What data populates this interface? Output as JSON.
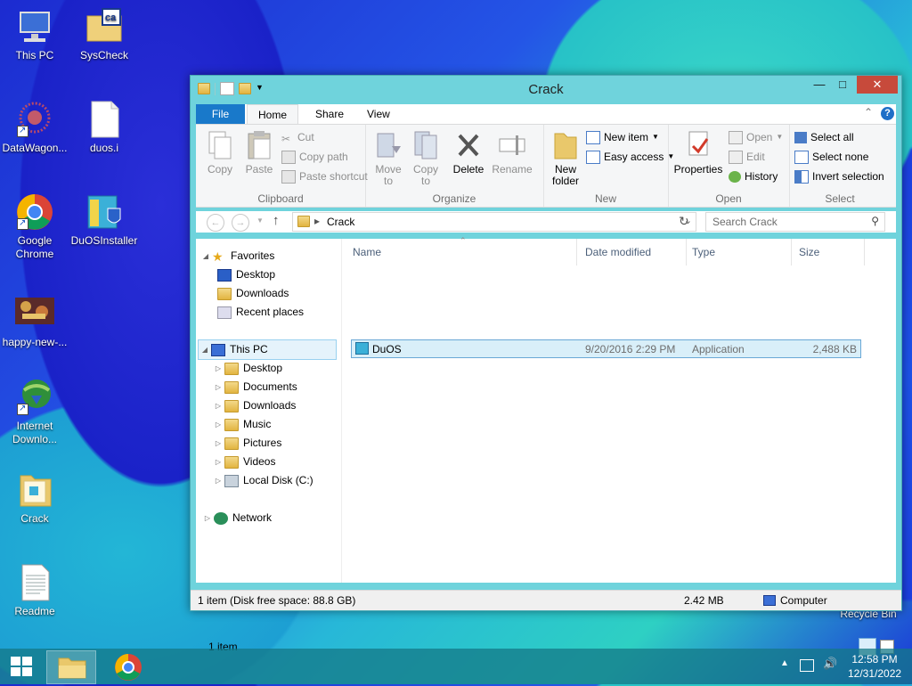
{
  "desktop": {
    "icons": [
      {
        "label": "This PC"
      },
      {
        "label": "SysCheck"
      },
      {
        "label": "DataWagon..."
      },
      {
        "label": "duos.i"
      },
      {
        "label": "Google Chrome"
      },
      {
        "label": "DuOSInstaller"
      },
      {
        "label": "happy-new-..."
      },
      {
        "label": "Internet Downlo..."
      },
      {
        "label": "Crack"
      },
      {
        "label": "Readme"
      },
      {
        "label": "Recycle Bin"
      }
    ]
  },
  "window": {
    "title": "Crack",
    "tabs": [
      "File",
      "Home",
      "Share",
      "View"
    ],
    "ribbon": {
      "clipboard": {
        "label": "Clipboard",
        "copy": "Copy",
        "paste": "Paste",
        "cut": "Cut",
        "copy_path": "Copy path",
        "paste_shortcut": "Paste shortcut"
      },
      "organize": {
        "label": "Organize",
        "move_to": "Move to",
        "copy_to": "Copy to",
        "delete": "Delete",
        "rename": "Rename"
      },
      "new": {
        "label": "New",
        "new_folder": "New folder",
        "new_item": "New item",
        "easy_access": "Easy access"
      },
      "open": {
        "label": "Open",
        "properties": "Properties",
        "open": "Open",
        "edit": "Edit",
        "history": "History"
      },
      "select": {
        "label": "Select",
        "select_all": "Select all",
        "select_none": "Select none",
        "invert": "Invert selection"
      }
    },
    "address": {
      "path": "Crack",
      "search_placeholder": "Search Crack"
    },
    "nav": {
      "favorites": "Favorites",
      "fav_items": [
        "Desktop",
        "Downloads",
        "Recent places"
      ],
      "this_pc": "This PC",
      "pc_items": [
        "Desktop",
        "Documents",
        "Downloads",
        "Music",
        "Pictures",
        "Videos",
        "Local Disk (C:)"
      ],
      "network": "Network"
    },
    "columns": [
      "Name",
      "Date modified",
      "Type",
      "Size"
    ],
    "files": [
      {
        "name": "DuOS",
        "date": "9/20/2016 2:29 PM",
        "type": "Application",
        "size": "2,488 KB"
      }
    ],
    "item_count": "1 item",
    "status": {
      "left": "1 item (Disk free space: 88.8 GB)",
      "size": "2.42 MB",
      "location": "Computer"
    }
  },
  "taskbar": {
    "time": "12:58 PM",
    "date": "12/31/2022"
  },
  "colors": {
    "accent": "#1979ca",
    "titlebar": "#6fd3dc",
    "close": "#c74a3b"
  }
}
